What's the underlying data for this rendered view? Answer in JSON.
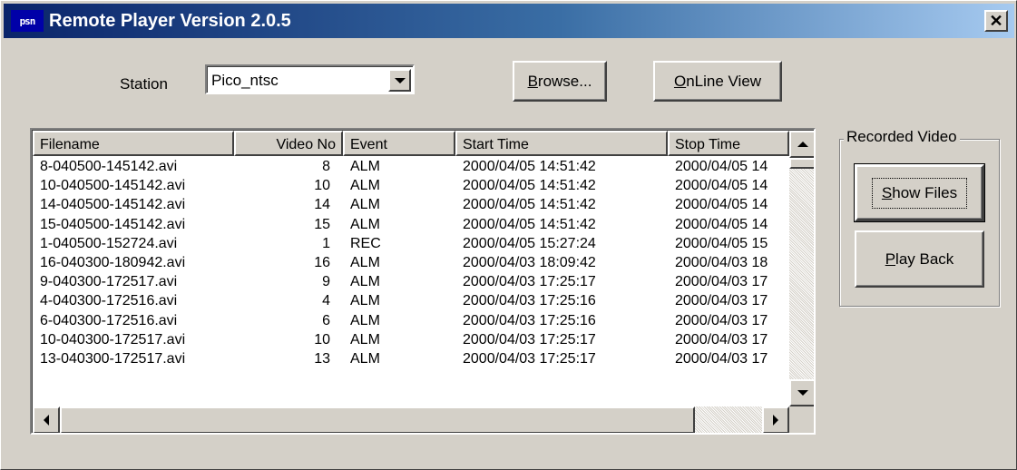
{
  "window": {
    "icon_text": "psn",
    "title": "Remote Player Version 2.0.5",
    "close_glyph": "✕"
  },
  "station": {
    "label": "Station",
    "selected": "Pico_ntsc"
  },
  "buttons": {
    "browse": {
      "accel": "B",
      "rest": "rowse..."
    },
    "online": {
      "accel": "O",
      "rest": "nLine View"
    },
    "show_files": {
      "accel": "S",
      "rest": "how Files"
    },
    "play_back": {
      "accel": "P",
      "rest": "lay Back"
    }
  },
  "group": {
    "label": "Recorded Video"
  },
  "table": {
    "columns": [
      "Filename",
      "Video No",
      "Event",
      "Start Time",
      "Stop Time"
    ],
    "rows": [
      [
        "8-040500-145142.avi",
        "8",
        "ALM",
        "2000/04/05 14:51:42",
        "2000/04/05 14"
      ],
      [
        "10-040500-145142.avi",
        "10",
        "ALM",
        "2000/04/05 14:51:42",
        "2000/04/05 14"
      ],
      [
        "14-040500-145142.avi",
        "14",
        "ALM",
        "2000/04/05 14:51:42",
        "2000/04/05 14"
      ],
      [
        "15-040500-145142.avi",
        "15",
        "ALM",
        "2000/04/05 14:51:42",
        "2000/04/05 14"
      ],
      [
        "1-040500-152724.avi",
        "1",
        "REC",
        "2000/04/05 15:27:24",
        "2000/04/05 15"
      ],
      [
        "16-040300-180942.avi",
        "16",
        "ALM",
        "2000/04/03 18:09:42",
        "2000/04/03 18"
      ],
      [
        "9-040300-172517.avi",
        "9",
        "ALM",
        "2000/04/03 17:25:17",
        "2000/04/03 17"
      ],
      [
        "4-040300-172516.avi",
        "4",
        "ALM",
        "2000/04/03 17:25:16",
        "2000/04/03 17"
      ],
      [
        "6-040300-172516.avi",
        "6",
        "ALM",
        "2000/04/03 17:25:16",
        "2000/04/03 17"
      ],
      [
        "10-040300-172517.avi",
        "10",
        "ALM",
        "2000/04/03 17:25:17",
        "2000/04/03 17"
      ],
      [
        "13-040300-172517.avi",
        "13",
        "ALM",
        "2000/04/03 17:25:17",
        "2000/04/03 17"
      ]
    ]
  },
  "colors": {
    "titlebar_start": "#0a246a",
    "titlebar_end": "#a6caf0",
    "face": "#d4d0c8"
  }
}
